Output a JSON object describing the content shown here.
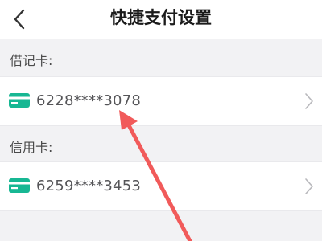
{
  "header": {
    "title": "快捷支付设置",
    "back_icon": "chevron-left-icon"
  },
  "debit": {
    "label": "借记卡:",
    "card": {
      "number": "6228****3078",
      "icon": "credit-card-icon"
    }
  },
  "credit": {
    "label": "信用卡:",
    "card": {
      "number": "6259****3453",
      "icon": "credit-card-icon"
    }
  },
  "colors": {
    "accent": "#17b793",
    "annotation": "#f15a5a"
  }
}
